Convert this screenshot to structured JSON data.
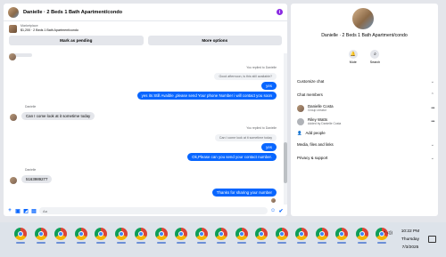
{
  "chat": {
    "title": "Danielle · 2 Beds 1 Bath Apartment/condo",
    "listing_source": "Marketplace",
    "listing_desc": "$1,200 · 2 Beds 1 Bath Apartment/condo",
    "mark_pending": "Mark as pending",
    "more_options": "More options",
    "messages": [
      {
        "meta": "You replied to Danielle",
        "quote": "Good afternoon, is this still available?",
        "text": "yes"
      },
      {
        "text": "yes its Still Avaible ,please send Your phone Number i will contact you soon"
      },
      {
        "sender": "Danielle",
        "text": "Can I come look at it sometime today"
      },
      {
        "meta": "You replied to Danielle",
        "quote": "Can I come look at it sometime today",
        "text": "yes"
      },
      {
        "text": "Ok,Please can you send your contact number."
      },
      {
        "sender": "Danielle",
        "text": "5163989277"
      },
      {
        "text": "Thanks for sharing your number"
      }
    ],
    "composer_placeholder": "Aa"
  },
  "side": {
    "title": "Danielle · 2 Beds 1 Bath Apartment/condo",
    "mute_label": "Mute",
    "search_label": "Search",
    "customize": "Customize chat",
    "members_header": "Chat members",
    "members": [
      {
        "name": "Danielle Costa",
        "sub": "Group creator"
      },
      {
        "name": "Riley Watts",
        "sub": "Added by Danielle Costa"
      }
    ],
    "add_people": "Add people",
    "media": "Media, files and links",
    "privacy": "Privacy & support"
  },
  "taskbar": {
    "time": "10:22 PM",
    "day": "Thursday",
    "date": "7/3/2025",
    "tray_glyph": "^ ◁))",
    "app_count": 19
  },
  "colors": {
    "accent": "#0866ff",
    "bubble_in": "#e4e6eb",
    "info_icon": "#8a2be2"
  }
}
